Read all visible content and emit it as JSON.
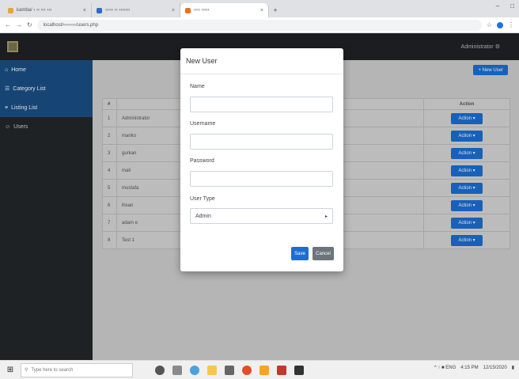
{
  "browser": {
    "tabs": [
      {
        "title": "kamba/ ‹ ‹‹ ‹‹‹ ‹‹‹",
        "active": false,
        "color": "#e8a33d"
      },
      {
        "title": "‹‹‹‹‹ ‹‹ ‹‹‹‹‹‹‹",
        "active": false,
        "color": "#3367d6"
      },
      {
        "title": "‹‹‹‹ ‹‹‹‹‹",
        "active": true,
        "color": "#e8711a"
      }
    ],
    "new_tab": "+",
    "url": "localhost/‹‹‹‹‹‹‹‹/users.php",
    "window_controls": [
      "–",
      "□"
    ]
  },
  "app": {
    "admin_label": "Administrator ⚙",
    "sidebar": [
      {
        "label": "Home",
        "icon": "⌂",
        "highlight": true
      },
      {
        "label": "Category List",
        "icon": "☰",
        "highlight": true
      },
      {
        "label": "Listing List",
        "icon": "≡",
        "highlight": true
      },
      {
        "label": "Users",
        "icon": "☺",
        "highlight": false
      }
    ],
    "add_button": "+ New User",
    "table": {
      "headers": [
        "#",
        "",
        "",
        "Action"
      ],
      "rows": [
        {
          "num": "1",
          "name": "Administrator",
          "action": "Action ▾"
        },
        {
          "num": "2",
          "name": "mariko",
          "action": "Action ▾"
        },
        {
          "num": "3",
          "name": "gurkan",
          "action": "Action ▾"
        },
        {
          "num": "4",
          "name": "mali",
          "action": "Action ▾"
        },
        {
          "num": "5",
          "name": "mustafa",
          "action": "Action ▾"
        },
        {
          "num": "6",
          "name": "ihsan",
          "action": "Action ▾"
        },
        {
          "num": "7",
          "name": "adam e",
          "action": "Action ▾"
        },
        {
          "num": "8",
          "name": "Test 1",
          "action": "Action ▾"
        }
      ]
    }
  },
  "modal": {
    "title": "New User",
    "name_label": "Name",
    "name_value": "",
    "username_label": "Username",
    "username_value": "",
    "password_label": "Password",
    "password_value": "",
    "usertype_label": "User Type",
    "usertype_selected": "Admin",
    "save_label": "Save",
    "cancel_label": "Cancel"
  },
  "taskbar": {
    "search_placeholder": "Type here to search",
    "tray_text": "^ ↑ ■ ENG",
    "clock": "4:15 PM",
    "date": "12/15/2020"
  },
  "colors": {
    "primary": "#1b6fd4",
    "sidebar_active": "#1a4f86",
    "navbar": "#1f2226"
  }
}
